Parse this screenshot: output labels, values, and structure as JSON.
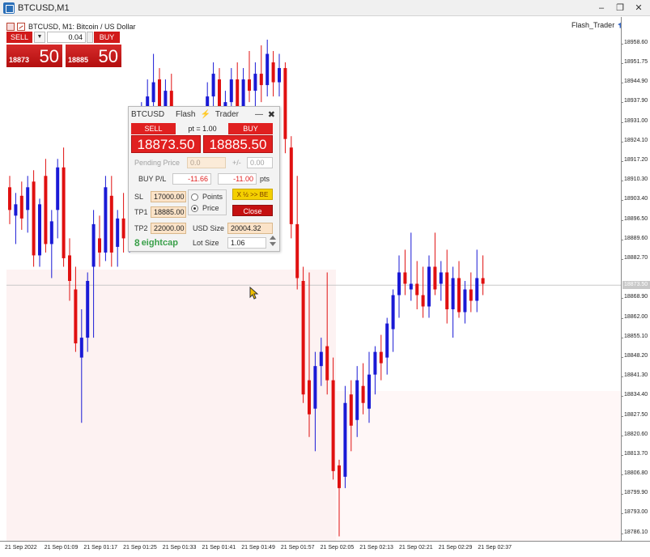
{
  "window": {
    "title": "BTCUSD,M1",
    "minimize": "–",
    "restore": "❐",
    "close": "✕"
  },
  "chart_header": {
    "symbol_text": "BTCUSD, M1:  Bitcoin / US Dollar",
    "ea_label": "Flash_Trader"
  },
  "one_click": {
    "sell_label": "SELL",
    "buy_label": "BUY",
    "lot": "0.04",
    "sell_price_small": "18873",
    "sell_price_big": "50",
    "buy_price_small": "18885",
    "buy_price_big": "50"
  },
  "flash_trader": {
    "symbol": "BTCUSD",
    "title_left": "Flash",
    "title_right": "Trader",
    "bolt": "⚡",
    "minimize": "—",
    "close": "✖",
    "sell_label": "SELL",
    "buy_label": "BUY",
    "pt_text": "pt = 1.00",
    "sell_price": "18873.50",
    "buy_price": "18885.50",
    "pending_label": "Pending Price",
    "pending_value": "0.0",
    "plus_minus_label": "+/-",
    "plus_minus_value": "0.00",
    "pl_label": "BUY  P/L",
    "pl_value": "-11.66",
    "pts_value": "-11.00",
    "pts_label": "pts",
    "sl_label": "SL",
    "sl_value": "17000.00",
    "tp1_label": "TP1",
    "tp1_value": "18885.00",
    "tp2_label": "TP2",
    "tp2_value": "22000.00",
    "radio_points": "Points",
    "radio_price": "Price",
    "be_button": "X ½ >> BE",
    "close_button": "Close",
    "usd_size_label": "USD Size",
    "usd_size_value": "20004.32",
    "lot_size_label": "Lot Size",
    "lot_size_value": "1.06",
    "brand": "eightcap",
    "brand_mark": "8"
  },
  "price_axis": {
    "ticks": [
      "18958.60",
      "18951.75",
      "18944.90",
      "18937.90",
      "18931.00",
      "18924.10",
      "18917.20",
      "18910.30",
      "18903.40",
      "18896.50",
      "18889.60",
      "18882.70",
      "18868.90",
      "18862.00",
      "18855.10",
      "18848.20",
      "18841.30",
      "18834.40",
      "18827.50",
      "18820.60",
      "18813.70",
      "18806.80",
      "18799.90",
      "18793.00",
      "18786.10"
    ],
    "current": "18873.50"
  },
  "time_axis": {
    "ticks": [
      "21 Sep 2022",
      "21 Sep 01:09",
      "21 Sep 01:17",
      "21 Sep 01:25",
      "21 Sep 01:33",
      "21 Sep 01:41",
      "21 Sep 01:49",
      "21 Sep 01:57",
      "21 Sep 02:05",
      "21 Sep 02:13",
      "21 Sep 02:21",
      "21 Sep 02:29",
      "21 Sep 02:37"
    ]
  },
  "colors": {
    "bull": "#1a1ad6",
    "bear": "#e01010",
    "current_line": "#c8c8c8"
  },
  "chart_data": {
    "type": "candlestick",
    "symbol": "BTCUSD",
    "timeframe": "M1",
    "ylim": [
      18784,
      18962
    ],
    "current_price": 18873.5,
    "candles": [
      {
        "o": 18908,
        "h": 18912,
        "l": 18895,
        "c": 18900
      },
      {
        "o": 18898,
        "h": 18906,
        "l": 18888,
        "c": 18902
      },
      {
        "o": 18905,
        "h": 18910,
        "l": 18893,
        "c": 18897
      },
      {
        "o": 18900,
        "h": 18912,
        "l": 18892,
        "c": 18908
      },
      {
        "o": 18910,
        "h": 18914,
        "l": 18880,
        "c": 18884
      },
      {
        "o": 18884,
        "h": 18904,
        "l": 18880,
        "c": 18902
      },
      {
        "o": 18912,
        "h": 18918,
        "l": 18885,
        "c": 18888
      },
      {
        "o": 18888,
        "h": 18900,
        "l": 18876,
        "c": 18896
      },
      {
        "o": 18900,
        "h": 18918,
        "l": 18890,
        "c": 18915
      },
      {
        "o": 18915,
        "h": 18922,
        "l": 18880,
        "c": 18883
      },
      {
        "o": 18884,
        "h": 18890,
        "l": 18868,
        "c": 18875
      },
      {
        "o": 18872,
        "h": 18880,
        "l": 18850,
        "c": 18853
      },
      {
        "o": 18848,
        "h": 18865,
        "l": 18825,
        "c": 18855
      },
      {
        "o": 18855,
        "h": 18878,
        "l": 18850,
        "c": 18875
      },
      {
        "o": 18880,
        "h": 18900,
        "l": 18855,
        "c": 18895
      },
      {
        "o": 18890,
        "h": 18898,
        "l": 18880,
        "c": 18885
      },
      {
        "o": 18885,
        "h": 18912,
        "l": 18882,
        "c": 18908
      },
      {
        "o": 18905,
        "h": 18912,
        "l": 18880,
        "c": 18885
      },
      {
        "o": 18887,
        "h": 18900,
        "l": 18880,
        "c": 18897
      },
      {
        "o": 18897,
        "h": 18906,
        "l": 18885,
        "c": 18890
      },
      {
        "o": 18890,
        "h": 18914,
        "l": 18885,
        "c": 18910
      },
      {
        "o": 18908,
        "h": 18922,
        "l": 18898,
        "c": 18918
      },
      {
        "o": 18918,
        "h": 18938,
        "l": 18912,
        "c": 18935
      },
      {
        "o": 18935,
        "h": 18946,
        "l": 18925,
        "c": 18940
      },
      {
        "o": 18938,
        "h": 18955,
        "l": 18930,
        "c": 18945
      },
      {
        "o": 18946,
        "h": 18950,
        "l": 18930,
        "c": 18934
      },
      {
        "o": 18934,
        "h": 18946,
        "l": 18928,
        "c": 18942
      },
      {
        "o": 18942,
        "h": 18948,
        "l": 18925,
        "c": 18930
      },
      {
        "o": 18930,
        "h": 18936,
        "l": 18910,
        "c": 18915
      },
      {
        "o": 18915,
        "h": 18926,
        "l": 18905,
        "c": 18920
      },
      {
        "o": 18920,
        "h": 18930,
        "l": 18912,
        "c": 18925
      },
      {
        "o": 18925,
        "h": 18935,
        "l": 18915,
        "c": 18918
      },
      {
        "o": 18918,
        "h": 18934,
        "l": 18910,
        "c": 18930
      },
      {
        "o": 18930,
        "h": 18945,
        "l": 18922,
        "c": 18940
      },
      {
        "o": 18940,
        "h": 18952,
        "l": 18930,
        "c": 18948
      },
      {
        "o": 18946,
        "h": 18950,
        "l": 18925,
        "c": 18930
      },
      {
        "o": 18930,
        "h": 18942,
        "l": 18925,
        "c": 18938
      },
      {
        "o": 18938,
        "h": 18950,
        "l": 18932,
        "c": 18946
      },
      {
        "o": 18946,
        "h": 18952,
        "l": 18930,
        "c": 18935
      },
      {
        "o": 18935,
        "h": 18950,
        "l": 18930,
        "c": 18946
      },
      {
        "o": 18946,
        "h": 18956,
        "l": 18938,
        "c": 18942
      },
      {
        "o": 18942,
        "h": 18952,
        "l": 18935,
        "c": 18948
      },
      {
        "o": 18948,
        "h": 18958,
        "l": 18938,
        "c": 18944
      },
      {
        "o": 18944,
        "h": 18960,
        "l": 18940,
        "c": 18955
      },
      {
        "o": 18952,
        "h": 18956,
        "l": 18940,
        "c": 18945
      },
      {
        "o": 18945,
        "h": 18955,
        "l": 18940,
        "c": 18950
      },
      {
        "o": 18950,
        "h": 18952,
        "l": 18920,
        "c": 18925
      },
      {
        "o": 18922,
        "h": 18926,
        "l": 18890,
        "c": 18895
      },
      {
        "o": 18895,
        "h": 18912,
        "l": 18872,
        "c": 18876
      },
      {
        "o": 18875,
        "h": 18880,
        "l": 18832,
        "c": 18835
      },
      {
        "o": 18840,
        "h": 18878,
        "l": 18820,
        "c": 18828
      },
      {
        "o": 18830,
        "h": 18850,
        "l": 18815,
        "c": 18845
      },
      {
        "o": 18845,
        "h": 18855,
        "l": 18838,
        "c": 18850
      },
      {
        "o": 18852,
        "h": 18878,
        "l": 18835,
        "c": 18840
      },
      {
        "o": 18840,
        "h": 18848,
        "l": 18805,
        "c": 18808
      },
      {
        "o": 18810,
        "h": 18812,
        "l": 18785,
        "c": 18802
      },
      {
        "o": 18806,
        "h": 18838,
        "l": 18802,
        "c": 18832
      },
      {
        "o": 18835,
        "h": 18840,
        "l": 18815,
        "c": 18824
      },
      {
        "o": 18826,
        "h": 18845,
        "l": 18820,
        "c": 18840
      },
      {
        "o": 18838,
        "h": 18846,
        "l": 18828,
        "c": 18832
      },
      {
        "o": 18830,
        "h": 18850,
        "l": 18825,
        "c": 18842
      },
      {
        "o": 18842,
        "h": 18852,
        "l": 18835,
        "c": 18850
      },
      {
        "o": 18850,
        "h": 18856,
        "l": 18840,
        "c": 18846
      },
      {
        "o": 18848,
        "h": 18862,
        "l": 18842,
        "c": 18860
      },
      {
        "o": 18858,
        "h": 18872,
        "l": 18850,
        "c": 18870
      },
      {
        "o": 18870,
        "h": 18884,
        "l": 18862,
        "c": 18878
      },
      {
        "o": 18878,
        "h": 18886,
        "l": 18870,
        "c": 18874
      },
      {
        "o": 18872,
        "h": 18892,
        "l": 18868,
        "c": 18874
      },
      {
        "o": 18874,
        "h": 18882,
        "l": 18865,
        "c": 18870
      },
      {
        "o": 18870,
        "h": 18880,
        "l": 18862,
        "c": 18866
      },
      {
        "o": 18866,
        "h": 18884,
        "l": 18862,
        "c": 18880
      },
      {
        "o": 18880,
        "h": 18892,
        "l": 18870,
        "c": 18872
      },
      {
        "o": 18874,
        "h": 18882,
        "l": 18868,
        "c": 18878
      },
      {
        "o": 18878,
        "h": 18886,
        "l": 18860,
        "c": 18865
      },
      {
        "o": 18865,
        "h": 18880,
        "l": 18855,
        "c": 18876
      },
      {
        "o": 18876,
        "h": 18882,
        "l": 18862,
        "c": 18864
      },
      {
        "o": 18864,
        "h": 18875,
        "l": 18860,
        "c": 18872
      },
      {
        "o": 18872,
        "h": 18878,
        "l": 18864,
        "c": 18868
      },
      {
        "o": 18868,
        "h": 18886,
        "l": 18864,
        "c": 18876
      },
      {
        "o": 18876,
        "h": 18884,
        "l": 18870,
        "c": 18874
      }
    ]
  }
}
